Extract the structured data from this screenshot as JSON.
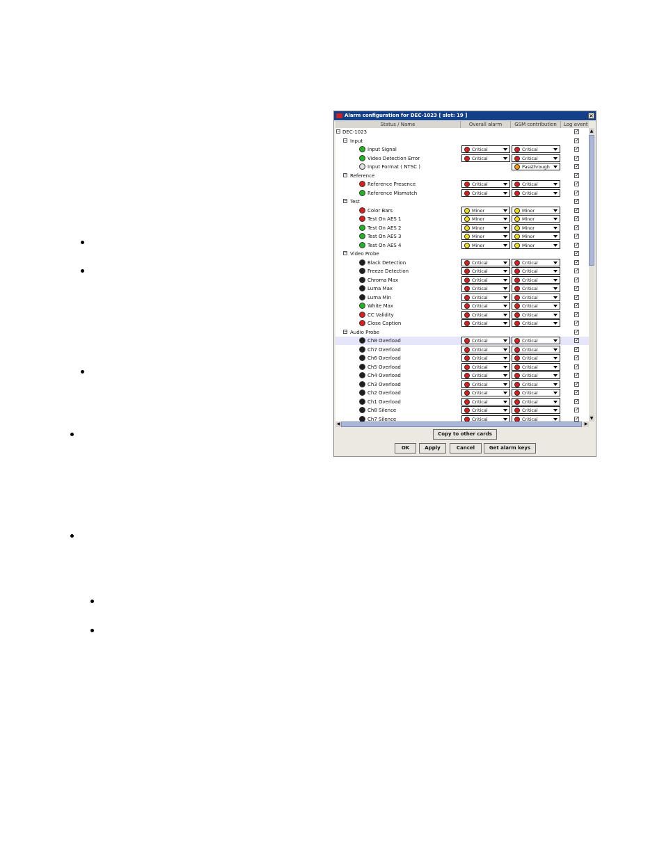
{
  "dialog": {
    "title": "Alarm configuration for DEC-1023 [ slot: 19 ]",
    "close_glyph": "×"
  },
  "columns": {
    "status_name": "Status / Name",
    "overall_alarm": "Overall alarm",
    "gsm_contribution": "GSM contribution",
    "log_events": "Log event"
  },
  "colors": {
    "red": "#d81e1e",
    "green": "#22b422",
    "yellow": "#f0e020",
    "black": "#1e1e1e",
    "gray": "#e0e0e0",
    "passthrough": "#ff9900"
  },
  "rows": [
    {
      "label": "DEC-1023",
      "level": 0,
      "expander": "⊟",
      "checked": true
    },
    {
      "label": "Input",
      "level": 1,
      "expander": "⊟",
      "checked": true
    },
    {
      "label": "Input Signal",
      "level": 2,
      "led": "green",
      "overall": "Critical",
      "overall_color": "red",
      "gsm": "Critical",
      "gsm_color": "red",
      "checked": true
    },
    {
      "label": "Video Detection Error",
      "level": 2,
      "led": "green",
      "overall": "Critical",
      "overall_color": "red",
      "gsm": "Critical",
      "gsm_color": "red",
      "checked": true
    },
    {
      "label": "Input Format ( NTSC )",
      "level": 2,
      "led": "gray",
      "gsm": "Passthrough",
      "gsm_color": "passthrough",
      "checked": true
    },
    {
      "label": "Reference",
      "level": 1,
      "expander": "⊟",
      "checked": true
    },
    {
      "label": "Reference Presence",
      "level": 2,
      "led": "red",
      "overall": "Critical",
      "overall_color": "red",
      "gsm": "Critical",
      "gsm_color": "red",
      "checked": true
    },
    {
      "label": "Reference Mismatch",
      "level": 2,
      "led": "green",
      "overall": "Critical",
      "overall_color": "red",
      "gsm": "Critical",
      "gsm_color": "red",
      "checked": true
    },
    {
      "label": "Test",
      "level": 1,
      "expander": "⊟",
      "checked": true
    },
    {
      "label": "Color Bars",
      "level": 2,
      "led": "red",
      "overall": "Minor",
      "overall_color": "yellow",
      "gsm": "Minor",
      "gsm_color": "yellow",
      "checked": true
    },
    {
      "label": "Test On AES 1",
      "level": 2,
      "led": "red",
      "overall": "Minor",
      "overall_color": "yellow",
      "gsm": "Minor",
      "gsm_color": "yellow",
      "checked": true
    },
    {
      "label": "Test On AES 2",
      "level": 2,
      "led": "green",
      "overall": "Minor",
      "overall_color": "yellow",
      "gsm": "Minor",
      "gsm_color": "yellow",
      "checked": true
    },
    {
      "label": "Test On AES 3",
      "level": 2,
      "led": "green",
      "overall": "Minor",
      "overall_color": "yellow",
      "gsm": "Minor",
      "gsm_color": "yellow",
      "checked": true
    },
    {
      "label": "Test On AES 4",
      "level": 2,
      "led": "green",
      "overall": "Minor",
      "overall_color": "yellow",
      "gsm": "Minor",
      "gsm_color": "yellow",
      "checked": true
    },
    {
      "label": "Video Probe",
      "level": 1,
      "expander": "⊟",
      "checked": true
    },
    {
      "label": "Black Detection",
      "level": 2,
      "led": "black",
      "overall": "Critical",
      "overall_color": "red",
      "gsm": "Critical",
      "gsm_color": "red",
      "checked": true
    },
    {
      "label": "Freeze Detection",
      "level": 2,
      "led": "black",
      "overall": "Critical",
      "overall_color": "red",
      "gsm": "Critical",
      "gsm_color": "red",
      "checked": true
    },
    {
      "label": "Chroma Max",
      "level": 2,
      "led": "black",
      "overall": "Critical",
      "overall_color": "red",
      "gsm": "Critical",
      "gsm_color": "red",
      "checked": true
    },
    {
      "label": "Luma Max",
      "level": 2,
      "led": "black",
      "overall": "Critical",
      "overall_color": "red",
      "gsm": "Critical",
      "gsm_color": "red",
      "checked": true
    },
    {
      "label": "Luma Min",
      "level": 2,
      "led": "black",
      "overall": "Critical",
      "overall_color": "red",
      "gsm": "Critical",
      "gsm_color": "red",
      "checked": true
    },
    {
      "label": "White Max",
      "level": 2,
      "led": "green",
      "overall": "Critical",
      "overall_color": "red",
      "gsm": "Critical",
      "gsm_color": "red",
      "checked": true
    },
    {
      "label": "CC Validity",
      "level": 2,
      "led": "red",
      "overall": "Critical",
      "overall_color": "red",
      "gsm": "Critical",
      "gsm_color": "red",
      "checked": true
    },
    {
      "label": "Close Caption",
      "level": 2,
      "led": "red",
      "overall": "Critical",
      "overall_color": "red",
      "gsm": "Critical",
      "gsm_color": "red",
      "checked": true
    },
    {
      "label": "Audio Probe",
      "level": 1,
      "expander": "⊟",
      "checked": true
    },
    {
      "label": "Ch8 Overload",
      "level": 2,
      "led": "black",
      "overall": "Critical",
      "overall_color": "red",
      "gsm": "Critical",
      "gsm_color": "red",
      "checked": true,
      "selected": true
    },
    {
      "label": "Ch7 Overload",
      "level": 2,
      "led": "black",
      "overall": "Critical",
      "overall_color": "red",
      "gsm": "Critical",
      "gsm_color": "red",
      "checked": true
    },
    {
      "label": "Ch6 Overload",
      "level": 2,
      "led": "black",
      "overall": "Critical",
      "overall_color": "red",
      "gsm": "Critical",
      "gsm_color": "red",
      "checked": true
    },
    {
      "label": "Ch5 Overload",
      "level": 2,
      "led": "black",
      "overall": "Critical",
      "overall_color": "red",
      "gsm": "Critical",
      "gsm_color": "red",
      "checked": true
    },
    {
      "label": "Ch4 Overload",
      "level": 2,
      "led": "black",
      "overall": "Critical",
      "overall_color": "red",
      "gsm": "Critical",
      "gsm_color": "red",
      "checked": true
    },
    {
      "label": "Ch3 Overload",
      "level": 2,
      "led": "black",
      "overall": "Critical",
      "overall_color": "red",
      "gsm": "Critical",
      "gsm_color": "red",
      "checked": true
    },
    {
      "label": "Ch2 Overload",
      "level": 2,
      "led": "black",
      "overall": "Critical",
      "overall_color": "red",
      "gsm": "Critical",
      "gsm_color": "red",
      "checked": true
    },
    {
      "label": "Ch1 Overload",
      "level": 2,
      "led": "black",
      "overall": "Critical",
      "overall_color": "red",
      "gsm": "Critical",
      "gsm_color": "red",
      "checked": true
    },
    {
      "label": "Ch8 Silence",
      "level": 2,
      "led": "black",
      "overall": "Critical",
      "overall_color": "red",
      "gsm": "Critical",
      "gsm_color": "red",
      "checked": true
    },
    {
      "label": "Ch7 Silence",
      "level": 2,
      "led": "black",
      "overall": "Critical",
      "overall_color": "red",
      "gsm": "Critical",
      "gsm_color": "red",
      "checked": true
    }
  ],
  "buttons": {
    "copy": "Copy to other cards",
    "ok": "OK",
    "apply": "Apply",
    "cancel": "Cancel",
    "get_keys": "Get alarm keys"
  },
  "scroll_glyphs": {
    "up": "▲",
    "down": "▼",
    "left": "◀",
    "right": "▶"
  }
}
